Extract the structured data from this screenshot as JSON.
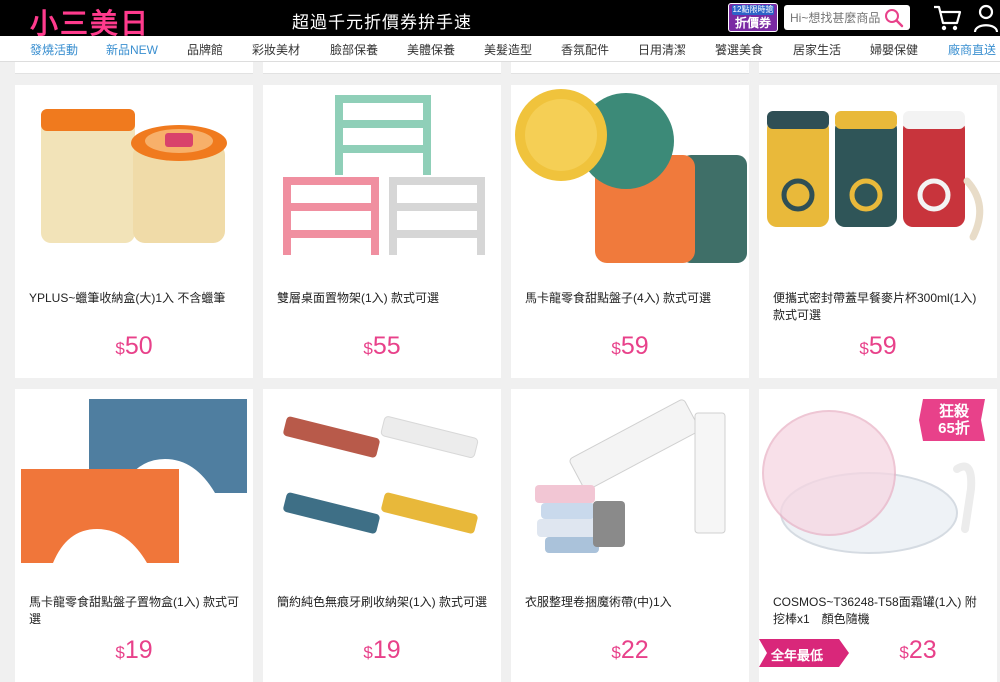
{
  "header": {
    "logo": "小三美日",
    "slogan": "超過千元折價券拚手速",
    "promo_line1": "12點限時搶",
    "promo_line2": "折價券",
    "search_placeholder": "Hi~想找甚麼商品",
    "colors": {
      "brand": "#ff3b8d",
      "topbar": "#000000",
      "price": "#e8418a",
      "nav_highlight": "#3a8fd0"
    }
  },
  "nav": [
    "發燒活動",
    "新品NEW",
    "品牌館",
    "彩妝美材",
    "臉部保養",
    "美體保養",
    "美髮造型",
    "香氛配件",
    "日用清潔",
    "饕選美食",
    "居家生活",
    "婦嬰保健",
    "廠商直送"
  ],
  "products": [
    {
      "name": "YPLUS~蠟筆收納盒(大)1入 不含蠟筆",
      "currency": "$",
      "price": "50"
    },
    {
      "name": "雙層桌面置物架(1入) 款式可選",
      "currency": "$",
      "price": "55"
    },
    {
      "name": "馬卡龍零食甜點盤子(4入) 款式可選",
      "currency": "$",
      "price": "59"
    },
    {
      "name": "便攜式密封帶蓋早餐麥片杯300ml(1入) 款式可選",
      "currency": "$",
      "price": "59"
    },
    {
      "name": "馬卡龍零食甜點盤子置物盒(1入) 款式可選",
      "currency": "$",
      "price": "19"
    },
    {
      "name": "簡約純色無痕牙刷收納架(1入) 款式可選",
      "currency": "$",
      "price": "19"
    },
    {
      "name": "衣服整理卷捆魔術帶(中)1入",
      "currency": "$",
      "price": "22"
    },
    {
      "name": "COSMOS~T36248-T58面霜罐(1入) 附挖棒x1　顏色隨機",
      "currency": "$",
      "price": "23",
      "badge_kill": "狂殺\n65折",
      "badge_kill_1": "狂殺",
      "badge_kill_2": "65折",
      "badge_year": "全年最低"
    }
  ]
}
